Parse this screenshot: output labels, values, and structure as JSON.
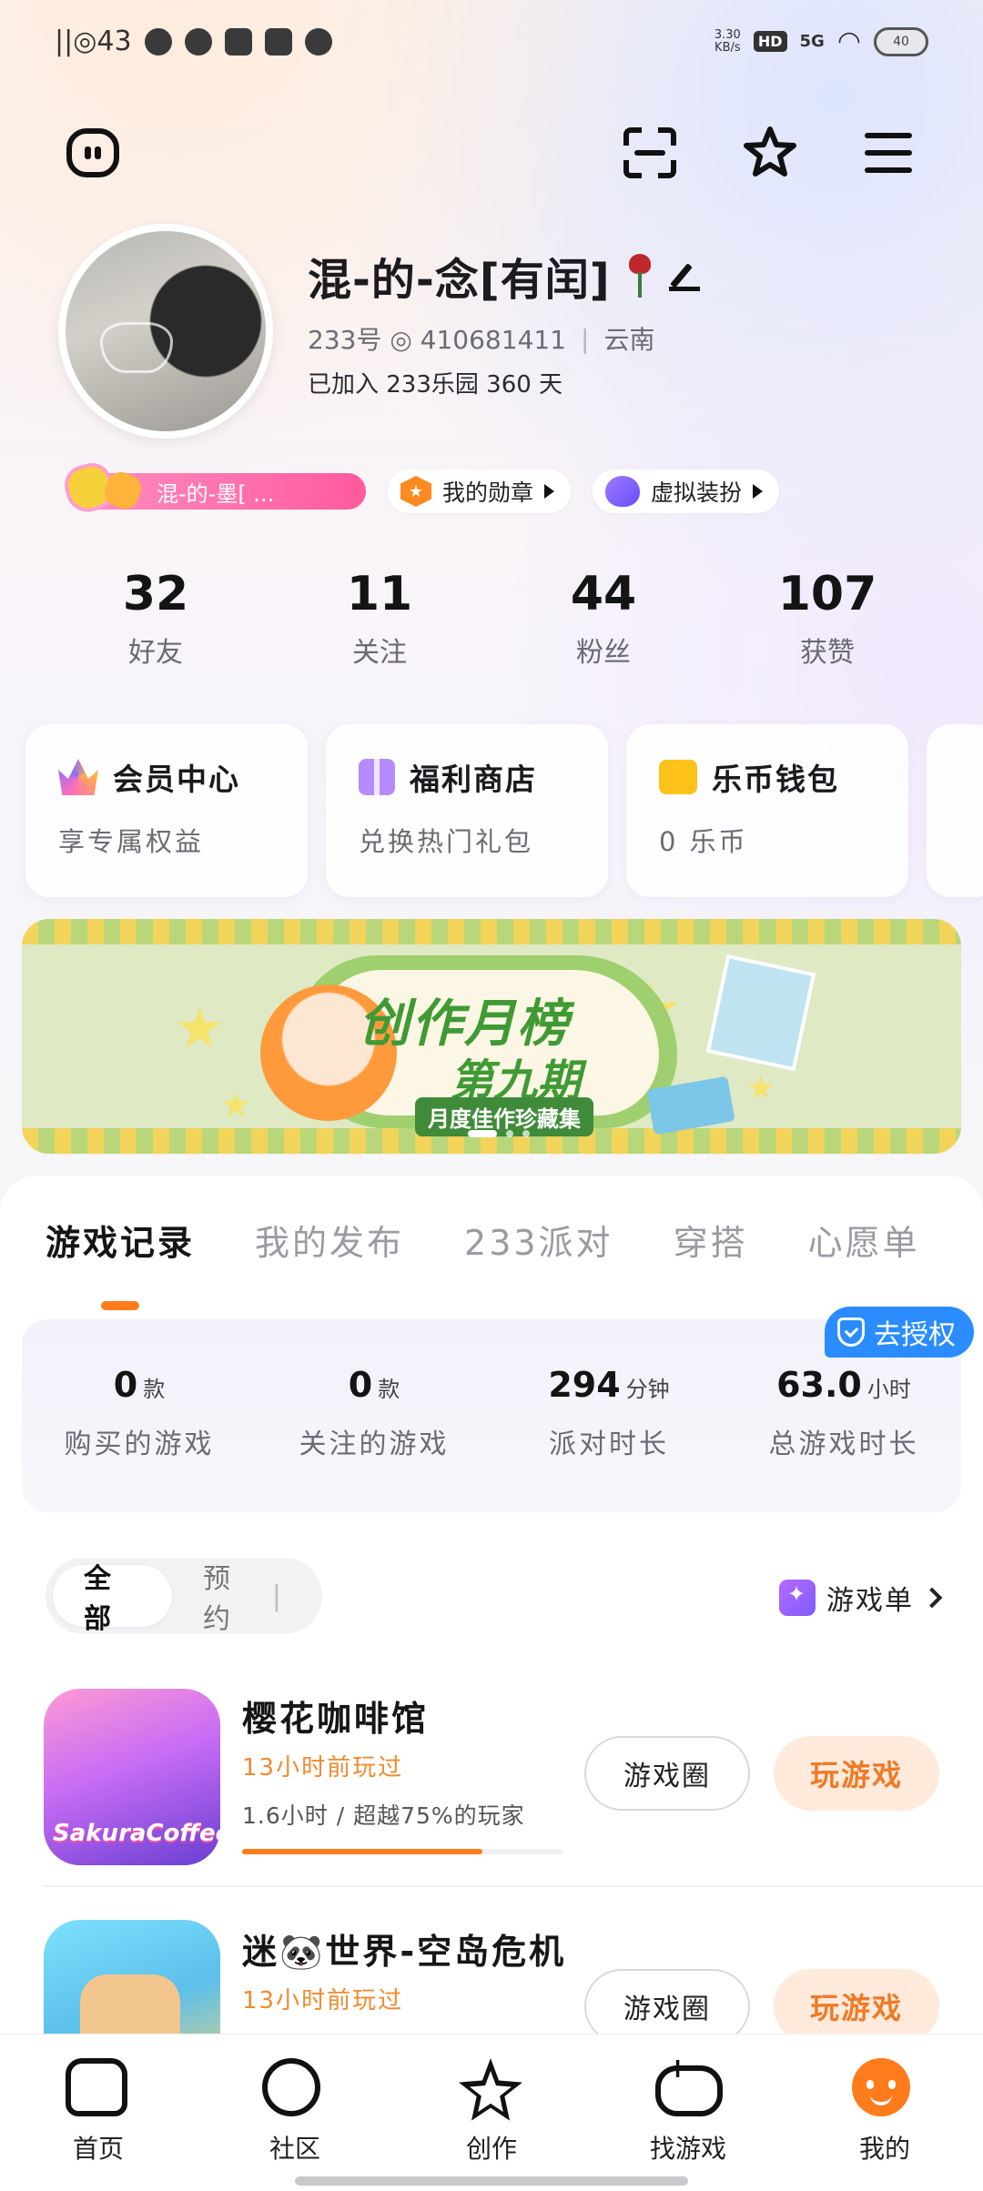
{
  "status_bar": {
    "left_text": "||◎43",
    "speed": "3.30",
    "speed_unit": "KB/s",
    "hd": "HD",
    "network": "5G",
    "battery": "40"
  },
  "header": {
    "left_icon": "chat-bubble-icon",
    "right_icons": [
      "scan-icon",
      "star-outline-icon",
      "menu-icon"
    ]
  },
  "profile": {
    "nickname": "混-的-念[有闰]",
    "id_line": "233号 ◎ 410681411",
    "region": "云南",
    "joined": "已加入 233乐园 360 天"
  },
  "badges": {
    "name_pill": "混-的-墨[ ...",
    "medal_label": "我的勋章",
    "dress_label": "虚拟装扮"
  },
  "stats": [
    {
      "value": "32",
      "label": "好友"
    },
    {
      "value": "11",
      "label": "关注"
    },
    {
      "value": "44",
      "label": "粉丝"
    },
    {
      "value": "107",
      "label": "获赞"
    }
  ],
  "cards": [
    {
      "title": "会员中心",
      "subtitle": "享专属权益",
      "icon": "crown-icon"
    },
    {
      "title": "福利商店",
      "subtitle": "兑换热门礼包",
      "icon": "gift-icon"
    },
    {
      "title": "乐币钱包",
      "subtitle": "0 乐币",
      "icon": "wallet-icon"
    }
  ],
  "banner": {
    "title": "创作月榜",
    "subtitle": "第九期",
    "tag": "月度佳作珍藏集",
    "active_dot": 0,
    "dot_count": 3
  },
  "tabs": [
    "游戏记录",
    "我的发布",
    "233派对",
    "穿搭",
    "心愿单"
  ],
  "active_tab": 0,
  "auth_tag": "去授权",
  "game_stats": [
    {
      "value": "0",
      "unit": "款",
      "label": "购买的游戏"
    },
    {
      "value": "0",
      "unit": "款",
      "label": "关注的游戏"
    },
    {
      "value": "294",
      "unit": "分钟",
      "label": "派对时长"
    },
    {
      "value": "63.0",
      "unit": "小时",
      "label": "总游戏时长"
    }
  ],
  "filter": {
    "all": "全部",
    "reserve": "预约"
  },
  "game_list_link": "游戏单",
  "games": [
    {
      "name": "樱花咖啡馆",
      "last_played": "13小时前玩过",
      "duration": "1.6小时 / 超越75%的玩家",
      "progress": 0.75,
      "icon_text": "SakuraCoffee",
      "circle_btn": "游戏圈",
      "play_btn": "玩游戏"
    },
    {
      "name": "迷🐼世界-空岛危机",
      "last_played": "13小时前玩过",
      "circle_btn": "游戏圈",
      "play_btn": "玩游戏"
    }
  ],
  "bottom_nav": [
    {
      "label": "首页",
      "icon": "home-icon"
    },
    {
      "label": "社区",
      "icon": "planet-icon"
    },
    {
      "label": "创作",
      "icon": "star-icon"
    },
    {
      "label": "找游戏",
      "icon": "gamepad-icon"
    },
    {
      "label": "我的",
      "icon": "me-icon"
    }
  ],
  "active_nav": 4
}
